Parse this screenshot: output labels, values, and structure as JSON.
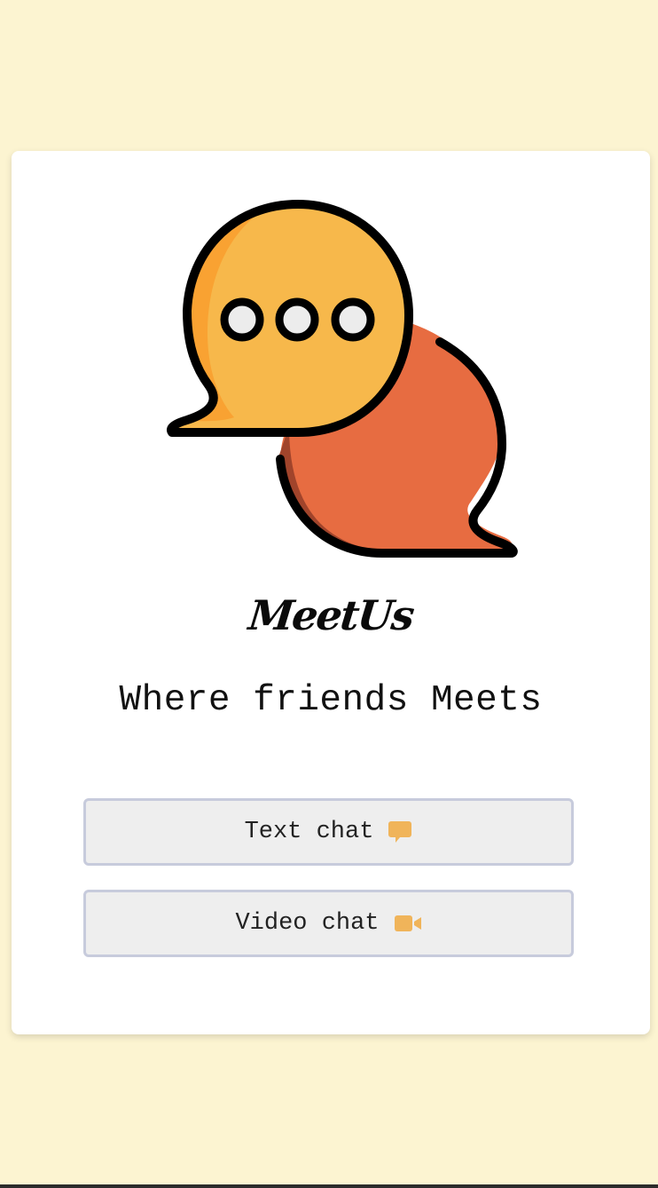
{
  "brand": {
    "name": "MeetUs",
    "tagline": "Where friends Meets"
  },
  "logo": {
    "icon": "speech-bubbles-logo",
    "colors": {
      "front_bubble": "#f7b84b",
      "front_bubble_shade": "#f9a232",
      "back_bubble": "#e76c41",
      "back_bubble_shade": "#a1442b",
      "dots": "#ececec",
      "outline": "#000000"
    }
  },
  "actions": {
    "text_chat": {
      "label": "Text chat",
      "icon": "comment-icon"
    },
    "video_chat": {
      "label": "Video chat",
      "icon": "video-camera-icon"
    }
  },
  "colors": {
    "background": "#fcf4d1",
    "card": "#ffffff",
    "button_bg": "#eeeeee",
    "button_border": "#c7cbdc",
    "icon_accent": "#f0b45a"
  }
}
